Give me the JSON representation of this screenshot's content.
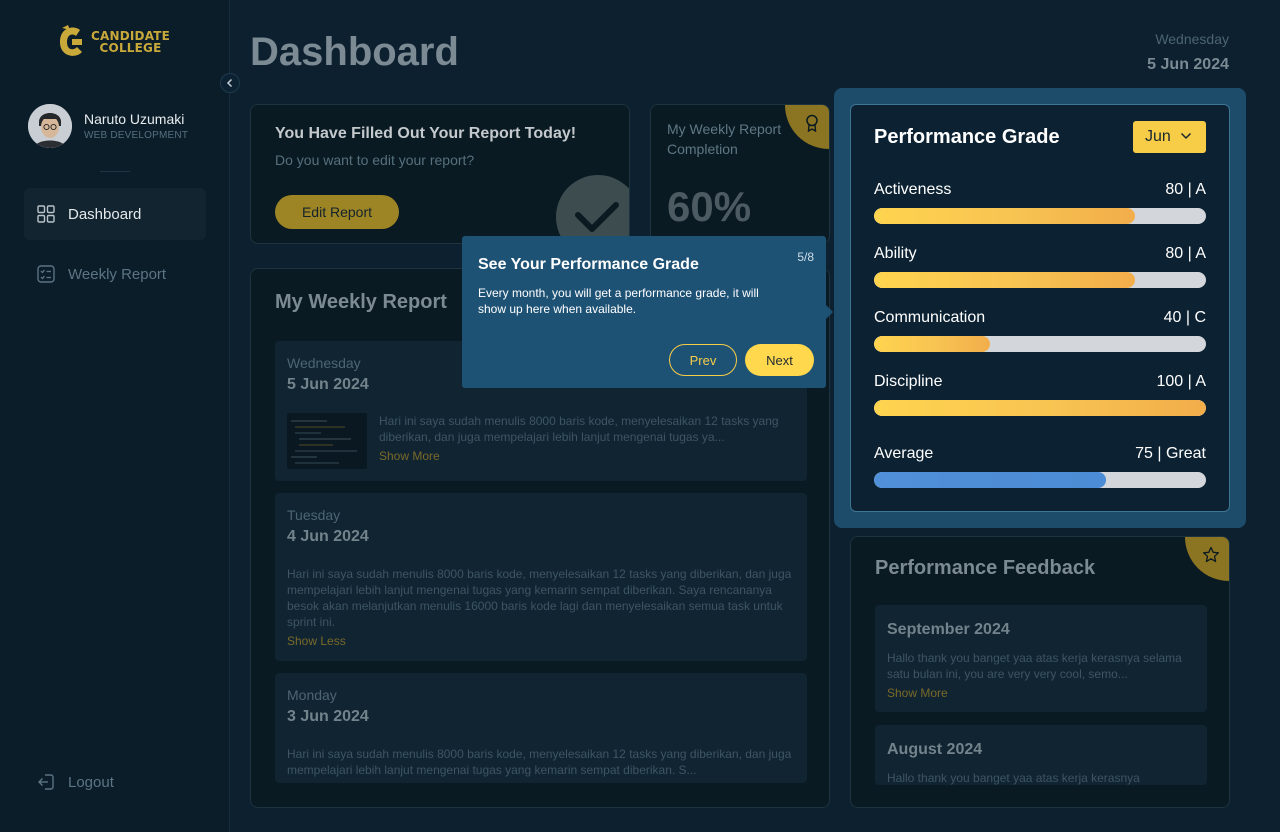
{
  "brand": {
    "line1": "CANDIDATE",
    "line2": "COLLEGE"
  },
  "user": {
    "name": "Naruto Uzumaki",
    "role": "WEB DEVELOPMENT"
  },
  "nav": {
    "dashboard": "Dashboard",
    "weekly_report": "Weekly Report",
    "logout": "Logout"
  },
  "header": {
    "title": "Dashboard",
    "day": "Wednesday",
    "date": "5 Jun 2024"
  },
  "filled_card": {
    "title": "You Have Filled Out Your Report Today!",
    "subtitle": "Do you want to edit your report?",
    "button": "Edit Report"
  },
  "completion": {
    "label": "My Weekly Report Completion",
    "value": "60%"
  },
  "weekly": {
    "title": "My Weekly Report",
    "items": [
      {
        "day": "Wednesday",
        "date": "5 Jun 2024",
        "text": "Hari ini saya sudah menulis 8000 baris kode, menyelesaikan 12 tasks yang diberikan, dan juga mempelajari lebih lanjut mengenai tugas ya...",
        "link": "Show More"
      },
      {
        "day": "Tuesday",
        "date": "4 Jun 2024",
        "text": "Hari ini saya sudah menulis 8000 baris kode, menyelesaikan 12 tasks yang diberikan, dan juga mempelajari lebih lanjut mengenai tugas yang kemarin sempat diberikan. Saya rencananya besok akan melanjutkan menulis 16000 baris kode lagi dan menyelesaikan semua task untuk sprint ini.",
        "link": "Show Less"
      },
      {
        "day": "Monday",
        "date": "3 Jun 2024",
        "text": "Hari ini saya sudah menulis 8000 baris kode, menyelesaikan 12 tasks yang diberikan, dan juga mempelajari lebih lanjut mengenai tugas yang kemarin sempat diberikan. S...",
        "link": ""
      }
    ]
  },
  "grade": {
    "title": "Performance Grade",
    "month": "Jun",
    "metrics": [
      {
        "name": "Activeness",
        "value": "80 | A",
        "percent": 0.785
      },
      {
        "name": "Ability",
        "value": "80 | A",
        "percent": 0.785
      },
      {
        "name": "Communication",
        "value": "40 | C",
        "percent": 0.35
      },
      {
        "name": "Discipline",
        "value": "100 | A",
        "percent": 1.0
      }
    ],
    "average": {
      "name": "Average",
      "value": "75 | Great",
      "percent": 0.7
    }
  },
  "feedback": {
    "title": "Performance Feedback",
    "items": [
      {
        "month": "September 2024",
        "text": "Hallo thank you banget yaa atas kerja kerasnya selama satu bulan ini, you are very very cool, semo...",
        "link": "Show More"
      },
      {
        "month": "August 2024",
        "text": "Hallo thank you banget yaa atas kerja kerasnya",
        "link": ""
      }
    ]
  },
  "tour": {
    "title": "See Your Performance Grade",
    "step": "5/8",
    "text": "Every month, you will get a performance grade, it will show up here when available.",
    "prev": "Prev",
    "next": "Next"
  },
  "colors": {
    "accent": "#F7CD47",
    "highlight": "#1D4C6B",
    "tour": "#1E5275",
    "average_bar": "#4C8BD5"
  },
  "icons": [
    "chevron-left-icon",
    "grid-icon",
    "report-list-icon",
    "logout-icon",
    "check-icon",
    "badge-icon",
    "star-icon",
    "chevron-down-icon"
  ]
}
